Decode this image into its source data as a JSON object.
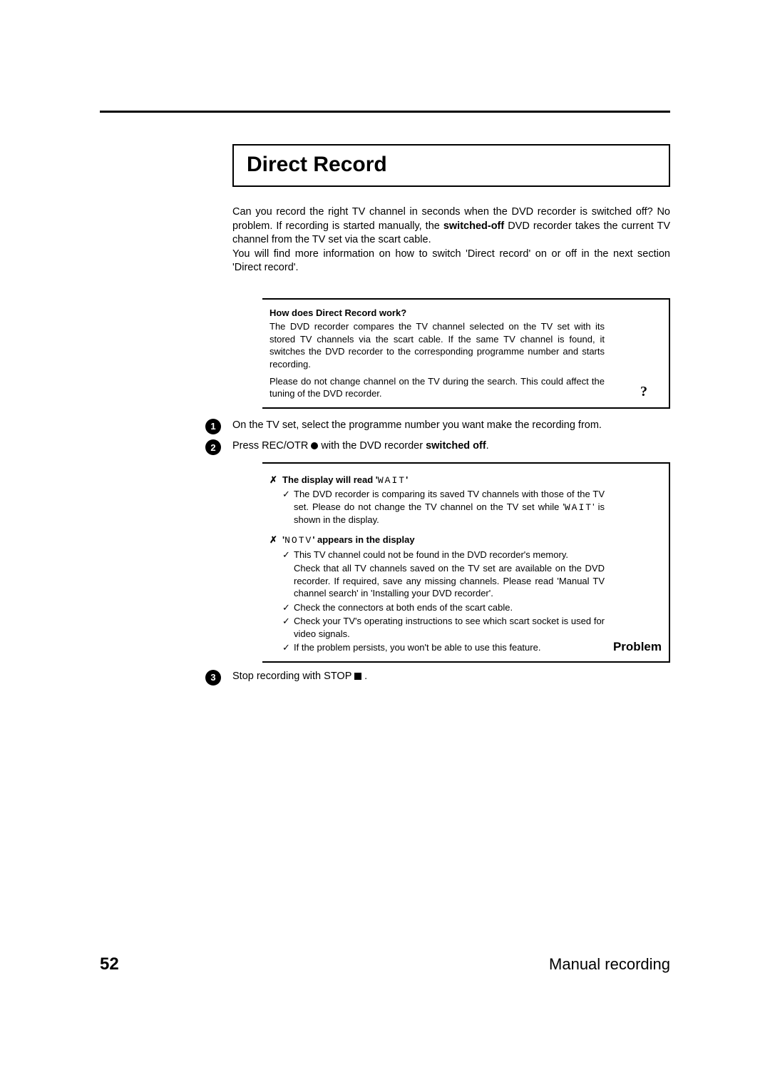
{
  "title": "Direct Record",
  "intro": {
    "p1a": "Can you record the right TV channel in seconds when the DVD recorder is switched off? No problem. If recording is started manually, the ",
    "p1bold": "switched-off",
    "p1b": " DVD recorder takes the current TV channel from the TV set via the scart cable.",
    "p2": "You will find more information on how to switch 'Direct record' on or off in the next section 'Direct record'."
  },
  "info": {
    "heading": "How does Direct Record work?",
    "body1": "The DVD recorder compares the TV channel selected on the TV set with its stored TV channels via the scart cable. If the same TV channel is found, it switches the DVD recorder to the corresponding programme number and starts recording.",
    "body2": "Please do not change channel on the TV during the search. This could affect the tuning of the DVD recorder.",
    "qmark": "?"
  },
  "steps": {
    "s1": "On the TV set, select the programme number you want make the recording from.",
    "s2a": "Press  REC/OTR ",
    "s2b": " with the DVD recorder ",
    "s2bold": "switched off",
    "s2c": ".",
    "s3a": "Stop recording with  STOP ",
    "s3b": " ."
  },
  "problem": {
    "x1a": "The display will read '",
    "wait": "WAIT",
    "x1b": "'",
    "c1a": "The DVD recorder is comparing its saved TV channels with those of the TV set. Please do not change the TV channel on the TV set while '",
    "c1b": "' is shown in the display.",
    "x2a": "'",
    "notv": "NOTV",
    "x2b": "' appears in the display",
    "c2": "This TV channel could not be found in the DVD recorder's memory.",
    "c3": "Check that all TV channels saved on the TV set are available on the DVD recorder. If required, save any missing channels. Please read 'Manual TV channel search' in 'Installing your DVD recorder'.",
    "c4": "Check the connectors at both ends of the scart cable.",
    "c5": "Check your TV's operating instructions to see which scart socket is used for video signals.",
    "c6": "If the problem persists, you won't be able to use this feature.",
    "label": "Problem"
  },
  "footer": {
    "page": "52",
    "section": "Manual recording"
  }
}
